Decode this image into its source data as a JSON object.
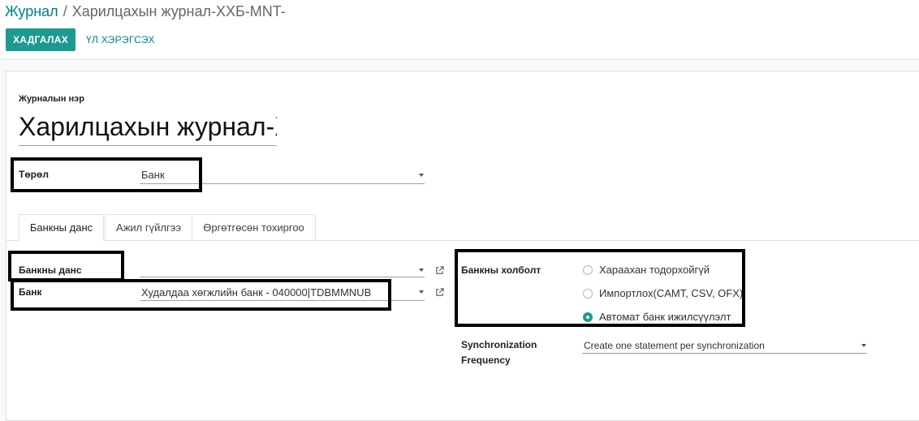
{
  "breadcrumb": {
    "parent": "Журнал",
    "separator": "/",
    "current": "Харилцахын журнал-ХХБ-MNT-"
  },
  "toolbar": {
    "save_label": "ХАДГАЛАХ",
    "tools_label": "ҮЛ ХЭРЭГСЭХ"
  },
  "form": {
    "journal_name_label": "Журналын нэр",
    "journal_name_value": "Харилцахын журнал-ХХБ-MNT-",
    "type_label": "Төрөл",
    "type_value": "Банк"
  },
  "tabs": [
    {
      "label": "Банкны данс",
      "active": true
    },
    {
      "label": "Ажил гүйлгээ",
      "active": false
    },
    {
      "label": "Өргөтгөсөн тохиргоо",
      "active": false
    }
  ],
  "bank_tab": {
    "account_label": "Банкны данс",
    "account_value": "",
    "bank_label": "Банк",
    "bank_value": "Худалдаа хөгжлийн банк - 040000|TDBMMNUB",
    "connection_label": "Банкны холболт",
    "connection_options": [
      {
        "label": "Хараахан тодорхойгүй",
        "checked": false
      },
      {
        "label": "Импортлох(CAMT, CSV, OFX)",
        "checked": false
      },
      {
        "label": "Автомат банк ижилсүүлэлт",
        "checked": true
      }
    ],
    "sync_label_line1": "Synchronization",
    "sync_label_line2": "Frequency",
    "sync_value": "Create one statement per synchronization"
  },
  "colors": {
    "brand": "#1d9a8f",
    "link": "#017e84"
  },
  "icons": [
    "external-link-icon",
    "caret-down-icon",
    "radio-icon"
  ]
}
